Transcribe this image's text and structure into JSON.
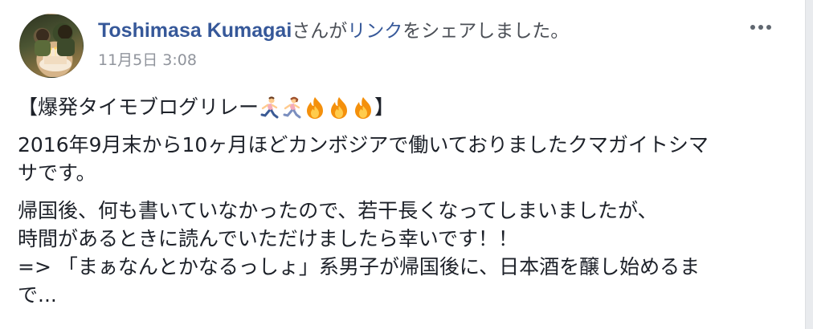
{
  "post": {
    "author": "Toshimasa Kumagai",
    "action_prefix": "さんが",
    "action_link": "リンク",
    "action_suffix": "をシェアしました。",
    "timestamp": "11月5日 3:08",
    "more_icon": "more-horizontal-icon"
  },
  "content": {
    "title_open": "【爆発タイモブログリレー",
    "title_close": "】",
    "title_emojis": [
      "runner-icon",
      "runner-icon",
      "fire-icon",
      "fire-icon",
      "fire-icon"
    ],
    "p1_line1": "2016年9月末から10ヶ月ほどカンボジアで働いておりましたクマガイトシマ",
    "p1_line2": "サです。",
    "p2_line1": "帰国後、何も書いていなかったので、若干長くなってしまいましたが、",
    "p2_line2": "時間があるときに読んでいただけましたら幸いです！！",
    "p2_line3": "=> 「まぁなんとかなるっしょ」系男子が帰国後に、日本酒を醸し始めるま",
    "p2_line4": "で..."
  },
  "colors": {
    "link": "#365899",
    "meta": "#90949c",
    "text": "#1d2129",
    "fire": "#f4900c",
    "runner": "#f4abba"
  }
}
